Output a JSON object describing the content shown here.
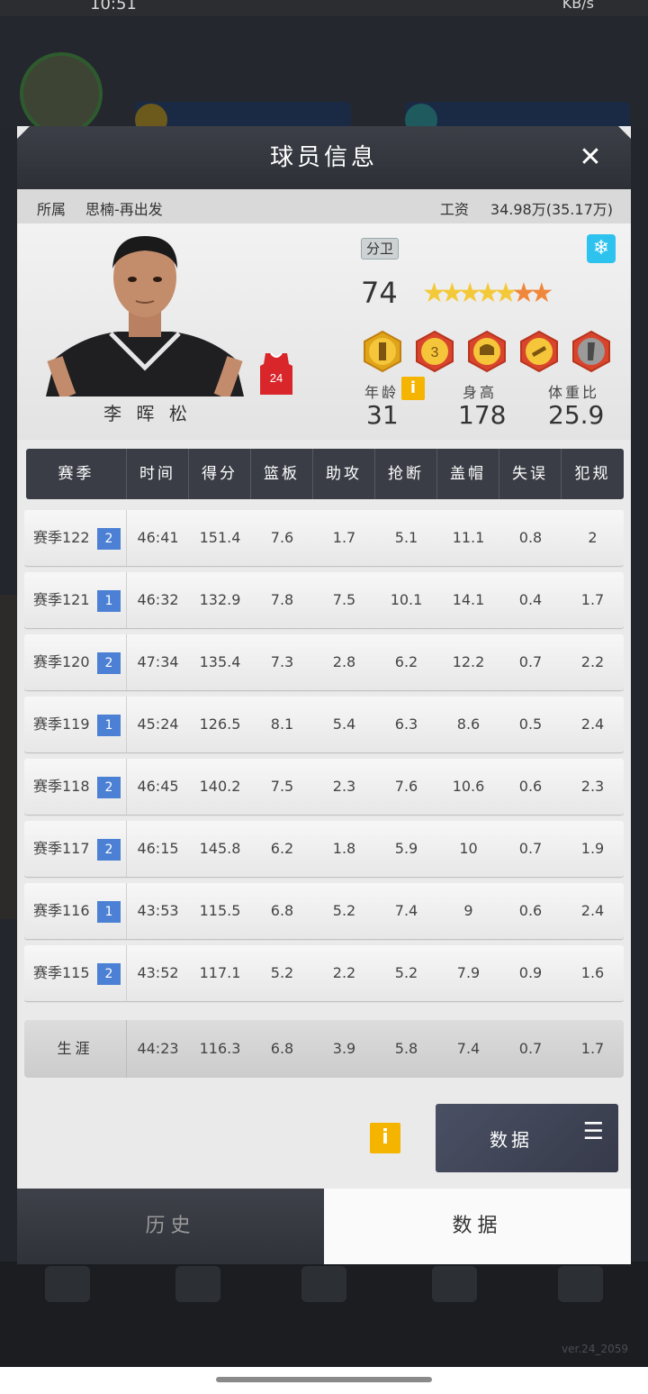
{
  "background": {
    "status_time": "10:51",
    "status_right": "KB/s",
    "version": "ver.24_2059",
    "nav_labels": [
      "",
      "",
      "",
      "",
      ""
    ]
  },
  "dialog": {
    "title": "球员信息",
    "close_icon": "close-icon",
    "affiliation_label": "所属",
    "affiliation_value": "思楠-再出发",
    "salary_label": "工资",
    "salary_value": "34.98万(35.17万)"
  },
  "player": {
    "name": "李 晖 松",
    "position": "分卫",
    "jersey_number": "24",
    "overall": "74",
    "stars_total": 7,
    "stars_gold": 4,
    "age_label": "年龄",
    "age": "31",
    "height_label": "身高",
    "height": "178",
    "bmi_label": "体重比",
    "bmi": "25.9",
    "skill_icons": [
      "post-up-skill-icon",
      "three-point-skill-icon",
      "defense-skill-icon",
      "shooting-skill-icon",
      "block-skill-icon"
    ]
  },
  "table": {
    "headers": [
      "赛季",
      "时间",
      "得分",
      "篮板",
      "助攻",
      "抢断",
      "盖帽",
      "失误",
      "犯规"
    ],
    "rows": [
      {
        "season": "赛季122",
        "level": "2",
        "time": "46:41",
        "pts": "151.4",
        "reb": "7.6",
        "ast": "1.7",
        "stl": "5.1",
        "blk": "11.1",
        "tov": "0.8",
        "foul": "2"
      },
      {
        "season": "赛季121",
        "level": "1",
        "time": "46:32",
        "pts": "132.9",
        "reb": "7.8",
        "ast": "7.5",
        "stl": "10.1",
        "blk": "14.1",
        "tov": "0.4",
        "foul": "1.7"
      },
      {
        "season": "赛季120",
        "level": "2",
        "time": "47:34",
        "pts": "135.4",
        "reb": "7.3",
        "ast": "2.8",
        "stl": "6.2",
        "blk": "12.2",
        "tov": "0.7",
        "foul": "2.2"
      },
      {
        "season": "赛季119",
        "level": "1",
        "time": "45:24",
        "pts": "126.5",
        "reb": "8.1",
        "ast": "5.4",
        "stl": "6.3",
        "blk": "8.6",
        "tov": "0.5",
        "foul": "2.4"
      },
      {
        "season": "赛季118",
        "level": "2",
        "time": "46:45",
        "pts": "140.2",
        "reb": "7.5",
        "ast": "2.3",
        "stl": "7.6",
        "blk": "10.6",
        "tov": "0.6",
        "foul": "2.3"
      },
      {
        "season": "赛季117",
        "level": "2",
        "time": "46:15",
        "pts": "145.8",
        "reb": "6.2",
        "ast": "1.8",
        "stl": "5.9",
        "blk": "10",
        "tov": "0.7",
        "foul": "1.9"
      },
      {
        "season": "赛季116",
        "level": "1",
        "time": "43:53",
        "pts": "115.5",
        "reb": "6.8",
        "ast": "5.2",
        "stl": "7.4",
        "blk": "9",
        "tov": "0.6",
        "foul": "2.4"
      },
      {
        "season": "赛季115",
        "level": "2",
        "time": "43:52",
        "pts": "117.1",
        "reb": "5.2",
        "ast": "2.2",
        "stl": "5.2",
        "blk": "7.9",
        "tov": "0.9",
        "foul": "1.6"
      }
    ],
    "career": {
      "season": "生涯",
      "time": "44:23",
      "pts": "116.3",
      "reb": "6.8",
      "ast": "3.9",
      "stl": "5.8",
      "blk": "7.4",
      "tov": "0.7",
      "foul": "1.7"
    }
  },
  "footer": {
    "info_icon": "i",
    "data_button_label": "数据",
    "menu_icon": "☰"
  },
  "tabs": {
    "history": "历史",
    "data": "数据"
  },
  "colors": {
    "dialog_header": "#2d3037",
    "level_badge": "#4b80d4",
    "info_badge": "#f4b400",
    "freeze_icon": "#2ec2ee"
  }
}
